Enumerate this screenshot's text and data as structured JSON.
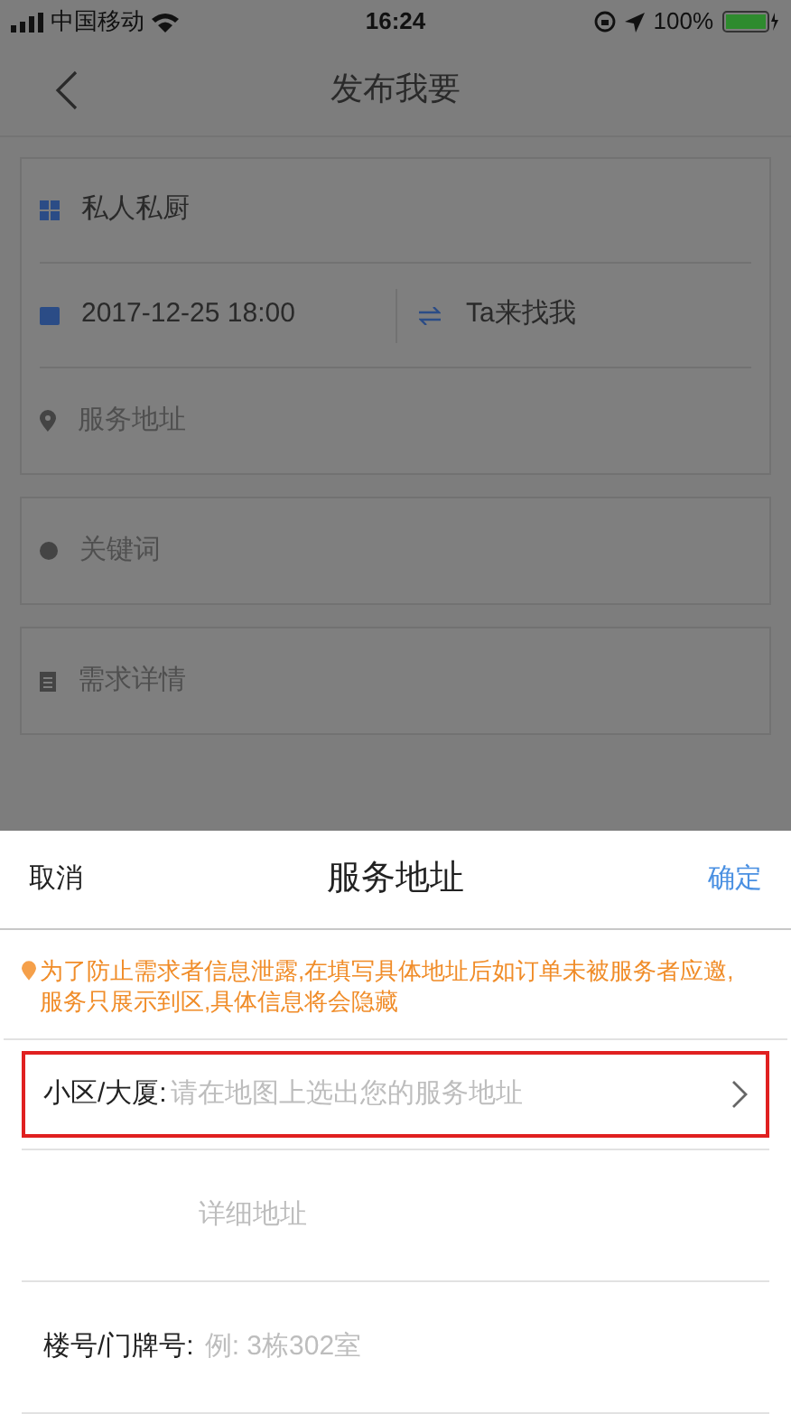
{
  "status_bar": {
    "carrier": "中国移动",
    "time": "16:24",
    "battery": "100%"
  },
  "nav": {
    "title": "发布我要"
  },
  "form": {
    "category": "私人私厨",
    "datetime": "2017-12-25 18:00",
    "mode": "Ta来找我",
    "address": {
      "placeholder": "服务地址"
    },
    "keywords": {
      "placeholder": "关键词"
    },
    "details": {
      "placeholder": "需求详情"
    }
  },
  "sheet": {
    "cancel": "取消",
    "title": "服务地址",
    "confirm": "确定",
    "notice": "为了防止需求者信息泄露,在填写具体地址后如订单未被服务者应邀,服务只展示到区,具体信息将会隐藏",
    "rows": [
      {
        "kind": "select",
        "label": "小区/大厦:",
        "placeholder": "请在地图上选出您的服务地址",
        "highlighted": true
      },
      {
        "kind": "text",
        "placeholder": "详细地址",
        "highlighted": false
      },
      {
        "kind": "text",
        "label": "楼号/门牌号:",
        "placeholder": "例: 3栋302室",
        "highlighted": false
      }
    ]
  }
}
